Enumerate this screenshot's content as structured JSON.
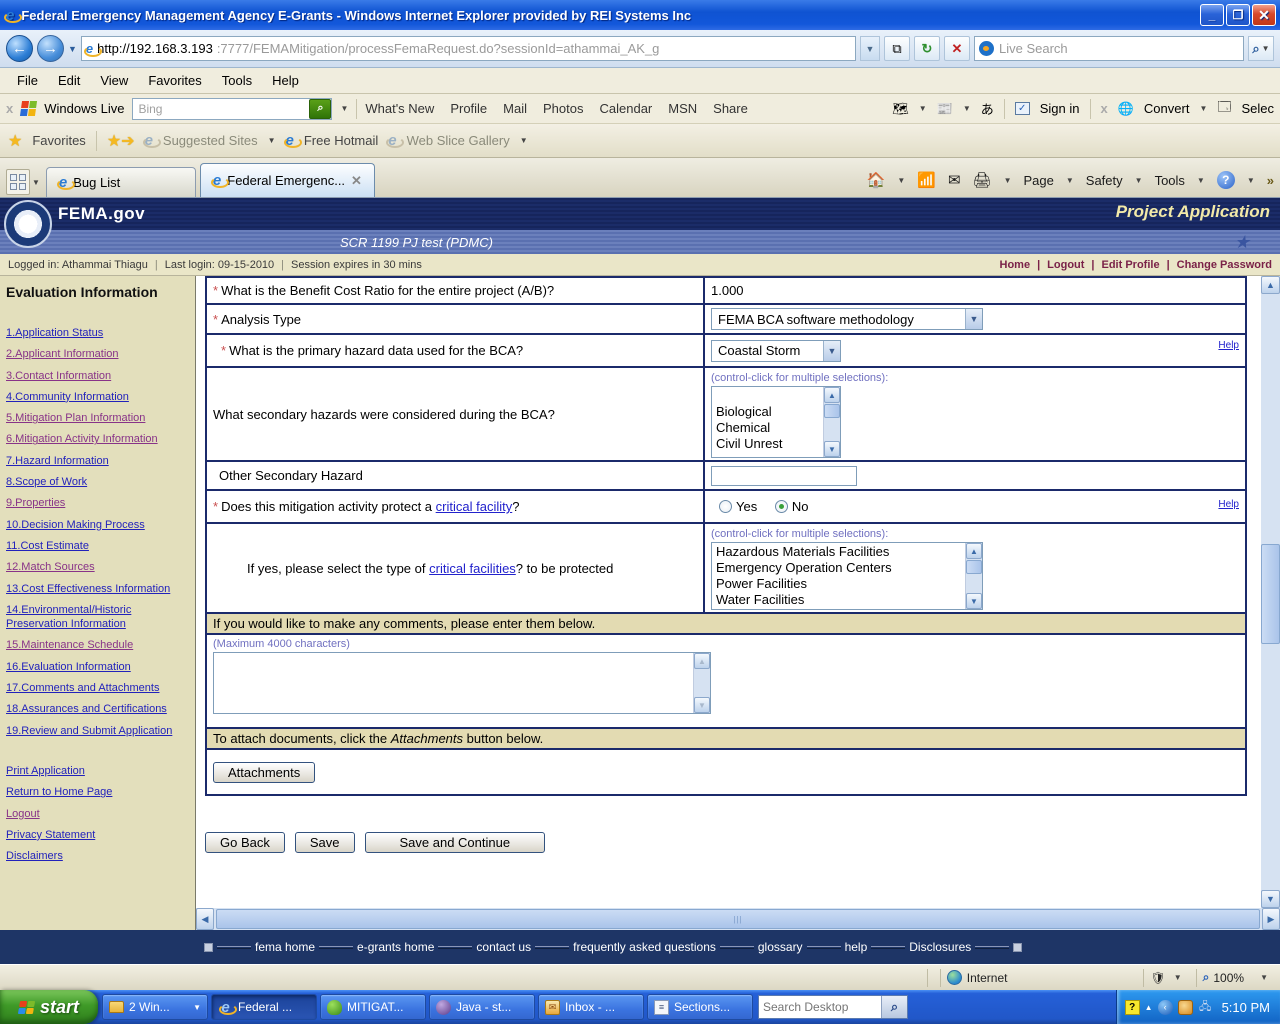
{
  "window": {
    "title": "Federal Emergency Management Agency E-Grants - Windows Internet Explorer provided by REI Systems Inc",
    "url_domain": "http://192.168.3.193",
    "url_rest": ":7777/FEMAMitigation/processFemaRequest.do?sessionId=athammai_AK_g",
    "live_search_placeholder": "Live Search"
  },
  "menu_bar": {
    "items": [
      "File",
      "Edit",
      "View",
      "Favorites",
      "Tools",
      "Help"
    ]
  },
  "live_toolbar": {
    "brand": "Windows Live",
    "search_placeholder": "Bing",
    "links": [
      "What's New",
      "Profile",
      "Mail",
      "Photos",
      "Calendar",
      "MSN",
      "Share"
    ],
    "sign_in": "Sign in",
    "convert": "Convert",
    "select": "Selec"
  },
  "favorites_bar": {
    "favorites": "Favorites",
    "suggested_sites": "Suggested Sites",
    "free_hotmail": "Free Hotmail",
    "web_slice": "Web Slice Gallery"
  },
  "tabs": {
    "tab1": "Bug List",
    "tab2": "Federal Emergenc..."
  },
  "command_bar": {
    "page": "Page",
    "safety": "Safety",
    "tools": "Tools"
  },
  "site_header": {
    "brand": "FEMA.gov",
    "page_title": "Project Application",
    "subtitle": "SCR 1199 PJ test (PDMC)",
    "logged_in": "Logged in: Athammai Thiagu",
    "last_login": "Last login: 09-15-2010",
    "session": "Session expires in 30 mins",
    "links": [
      "Home",
      "Logout",
      "Edit Profile",
      "Change Password"
    ]
  },
  "sidebar": {
    "heading": "Evaluation Information",
    "items": [
      {
        "label": "1.Application Status",
        "c": ""
      },
      {
        "label": "2.Applicant Information",
        "c": "visited"
      },
      {
        "label": "3.Contact Information",
        "c": "visited"
      },
      {
        "label": "4.Community Information",
        "c": ""
      },
      {
        "label": "5.Mitigation Plan Information",
        "c": "visited"
      },
      {
        "label": "6.Mitigation Activity Information",
        "c": "visited"
      },
      {
        "label": "7.Hazard Information",
        "c": ""
      },
      {
        "label": "8.Scope of Work",
        "c": ""
      },
      {
        "label": "9.Properties",
        "c": "visited"
      },
      {
        "label": "10.Decision Making Process",
        "c": ""
      },
      {
        "label": "11.Cost Estimate",
        "c": ""
      },
      {
        "label": "12.Match Sources",
        "c": "visited"
      },
      {
        "label": "13.Cost Effectiveness Information",
        "c": ""
      },
      {
        "label": "14.Environmental/Historic Preservation Information",
        "c": ""
      },
      {
        "label": "15.Maintenance Schedule",
        "c": "visited"
      },
      {
        "label": "16.Evaluation Information",
        "c": ""
      },
      {
        "label": "17.Comments and Attachments",
        "c": ""
      },
      {
        "label": "18.Assurances and Certifications",
        "c": ""
      },
      {
        "label": "19.Review and Submit Application",
        "c": ""
      }
    ],
    "footer_items": [
      {
        "label": "Print Application",
        "c": ""
      },
      {
        "label": "Return to Home Page",
        "c": ""
      },
      {
        "label": "Logout",
        "c": "visited"
      },
      {
        "label": "Privacy Statement",
        "c": ""
      },
      {
        "label": "Disclaimers",
        "c": ""
      }
    ]
  },
  "form": {
    "bcr": {
      "label": "What is the Benefit Cost Ratio for the entire project (A/B)?",
      "value": "1.000"
    },
    "analysis_type": {
      "label": "Analysis Type",
      "value": "FEMA BCA software methodology"
    },
    "primary_hazard": {
      "label": "What is the primary hazard data used for the BCA?",
      "value": "Coastal Storm",
      "help": "Help"
    },
    "secondary_hazards": {
      "label": "What secondary hazards were considered during the BCA?",
      "hint": "(control-click for multiple selections):",
      "options": [
        "",
        "Biological",
        "Chemical",
        "Civil Unrest"
      ]
    },
    "other_secondary": {
      "label": "Other Secondary Hazard",
      "value": ""
    },
    "critical_facility": {
      "label_pre": "Does this mitigation activity protect a ",
      "label_link": "critical facility",
      "label_post": "?",
      "yes": "Yes",
      "no": "No",
      "selected": "No",
      "help": "Help"
    },
    "critical_types": {
      "label_pre": "If yes, please select the type of ",
      "label_link": "critical facilities",
      "label_post": "? to be protected",
      "hint": "(control-click for multiple selections):",
      "options": [
        "Hazardous Materials Facilities",
        "Emergency Operation Centers",
        "Power Facilities",
        "Water Facilities"
      ]
    },
    "comments_header": "If you would like to make any comments, please enter them below.",
    "comments_hint": "(Maximum 4000 characters)",
    "comments_value": "",
    "attach_pre": "To attach documents, click the ",
    "attach_italic": "Attachments",
    "attach_post": " button below.",
    "attachments_button": "Attachments",
    "buttons": {
      "go_back": "Go Back",
      "save": "Save",
      "save_continue": "Save and Continue"
    }
  },
  "footer": {
    "links": [
      "fema home",
      "e-grants home",
      "contact us",
      "frequently asked questions",
      "glossary",
      "help",
      "Disclosures"
    ]
  },
  "status_bar": {
    "zone": "Internet",
    "zoom": "100%"
  },
  "taskbar": {
    "start": "start",
    "tasks": [
      "2 Win...",
      "Federal ...",
      "MITIGAT...",
      "Java - st...",
      "Inbox - ...",
      "Sections..."
    ],
    "search_placeholder": "Search Desktop",
    "time": "5:10 PM"
  }
}
